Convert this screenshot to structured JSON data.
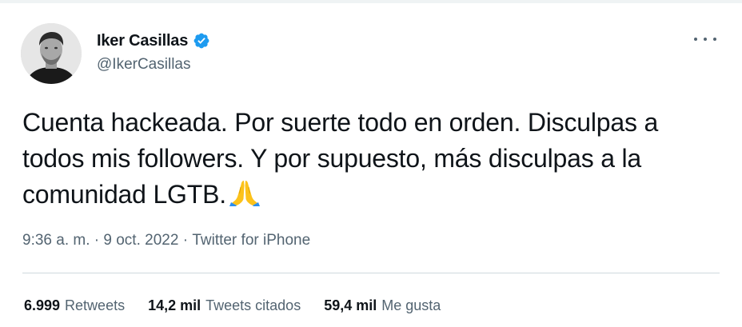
{
  "user": {
    "display_name": "Iker Casillas",
    "handle": "@IkerCasillas",
    "verified": true
  },
  "tweet": {
    "text": "Cuenta hackeada. Por suerte todo en orden. Disculpas a todos mis followers. Y por supuesto, más disculpas a la comunidad LGTB.",
    "emoji": "folded-hands-icon"
  },
  "meta": {
    "time": "9:36 a. m.",
    "date": "9 oct. 2022",
    "separator": " · ",
    "source": "Twitter for iPhone"
  },
  "stats": [
    {
      "count": "6.999",
      "label": "Retweets"
    },
    {
      "count": "14,2 mil",
      "label": "Tweets citados"
    },
    {
      "count": "59,4 mil",
      "label": "Me gusta"
    }
  ],
  "colors": {
    "verified_blue": "#1d9bf0",
    "secondary_text": "#536471",
    "primary_text": "#0f1419",
    "divider": "#cfd9de"
  }
}
